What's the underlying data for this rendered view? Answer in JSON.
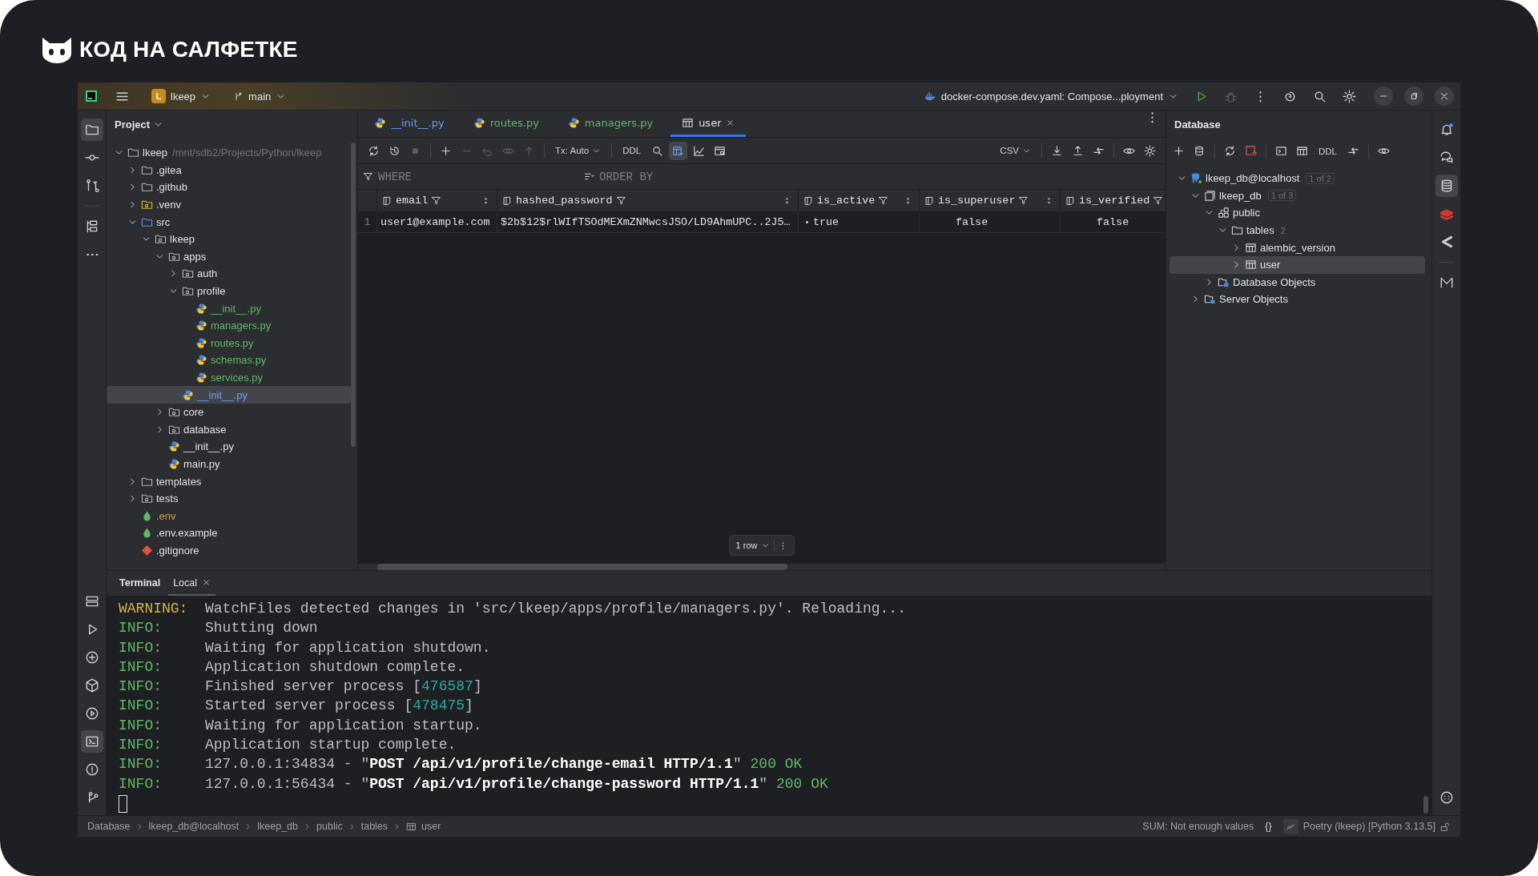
{
  "brand": {
    "name": "КОД НА САЛФЕТКЕ"
  },
  "title_bar": {
    "project_badge": "L",
    "project": "lkeep",
    "branch": "main",
    "run_config": "docker-compose.dev.yaml: Compose...ployment"
  },
  "project_panel": {
    "title": "Project",
    "tree": [
      {
        "label": "lkeep",
        "path": "/mnt/sdb2/Projects/Python/lkeep",
        "kind": "folder",
        "expanded": true,
        "selected": false,
        "color": "#dfe1e5",
        "children": [
          {
            "label": ".gitea",
            "kind": "folder",
            "expanded": false,
            "selected": false,
            "color": "#dfe1e5"
          },
          {
            "label": ".github",
            "kind": "folder",
            "expanded": false,
            "selected": false,
            "color": "#dfe1e5"
          },
          {
            "label": ".venv",
            "kind": "venv",
            "expanded": false,
            "selected": false,
            "color": "#dfe1e5"
          },
          {
            "label": "src",
            "kind": "source",
            "expanded": true,
            "selected": false,
            "color": "#dfe1e5",
            "children": [
              {
                "label": "lkeep",
                "kind": "package",
                "expanded": true,
                "selected": false,
                "color": "#dfe1e5",
                "children": [
                  {
                    "label": "apps",
                    "kind": "package",
                    "expanded": true,
                    "selected": false,
                    "color": "#dfe1e5",
                    "children": [
                      {
                        "label": "auth",
                        "kind": "package",
                        "expanded": false,
                        "selected": false,
                        "color": "#dfe1e5"
                      },
                      {
                        "label": "profile",
                        "kind": "package",
                        "expanded": true,
                        "selected": false,
                        "color": "#dfe1e5",
                        "children": [
                          {
                            "label": "__init__.py",
                            "kind": "python",
                            "selected": false,
                            "color": "#5fb865"
                          },
                          {
                            "label": "managers.py",
                            "kind": "python",
                            "selected": false,
                            "color": "#5fb865"
                          },
                          {
                            "label": "routes.py",
                            "kind": "python",
                            "selected": false,
                            "color": "#5fb865"
                          },
                          {
                            "label": "schemas.py",
                            "kind": "python",
                            "selected": false,
                            "color": "#5fb865"
                          },
                          {
                            "label": "services.py",
                            "kind": "python",
                            "selected": false,
                            "color": "#5fb865"
                          }
                        ]
                      },
                      {
                        "label": "__init__.py",
                        "kind": "python",
                        "selected": true,
                        "color": "#6c9ef8"
                      }
                    ]
                  },
                  {
                    "label": "core",
                    "kind": "package",
                    "expanded": false,
                    "selected": false,
                    "color": "#dfe1e5"
                  },
                  {
                    "label": "database",
                    "kind": "package",
                    "expanded": false,
                    "selected": false,
                    "color": "#dfe1e5"
                  },
                  {
                    "label": "__init__.py",
                    "kind": "python",
                    "selected": false,
                    "color": "#dfe1e5"
                  },
                  {
                    "label": "main.py",
                    "kind": "python",
                    "selected": false,
                    "color": "#dfe1e5"
                  }
                ]
              }
            ]
          },
          {
            "label": "templates",
            "kind": "folder",
            "expanded": false,
            "selected": false,
            "color": "#dfe1e5"
          },
          {
            "label": "tests",
            "kind": "package",
            "expanded": false,
            "selected": false,
            "color": "#dfe1e5"
          },
          {
            "label": ".env",
            "kind": "env",
            "selected": false,
            "color": "#d29a58"
          },
          {
            "label": ".env.example",
            "kind": "env",
            "selected": false,
            "color": "#dfe1e5"
          },
          {
            "label": ".gitignore",
            "kind": "git",
            "selected": false,
            "color": "#dfe1e5"
          }
        ]
      }
    ]
  },
  "editor": {
    "tabs": [
      {
        "label": "__init__.py",
        "kind": "python",
        "selected": false,
        "color": "#6c9ef8"
      },
      {
        "label": "routes.py",
        "kind": "python",
        "selected": false,
        "color": "#5fb865"
      },
      {
        "label": "managers.py",
        "kind": "python",
        "selected": false,
        "color": "#5fb865"
      },
      {
        "label": "user",
        "kind": "table",
        "selected": true,
        "color": "#dfe1e5"
      }
    ],
    "toolbar": {
      "transaction": "Tx: Auto",
      "ddl": "DDL",
      "export_format": "CSV"
    },
    "filter": {
      "where": "WHERE",
      "order_by": "ORDER BY"
    },
    "grid": {
      "columns": [
        {
          "name": "email"
        },
        {
          "name": "hashed_password"
        },
        {
          "name": "is_active"
        },
        {
          "name": "is_superuser"
        },
        {
          "name": "is_verified"
        }
      ],
      "rows": [
        {
          "number": "1",
          "cells": [
            {
              "text": "user1@example.com",
              "kind": "text",
              "current": false
            },
            {
              "text": "$2b$12$rlWIfTSOdMEXmZNMwcsJSO/LD9AhmUPC..2J5…",
              "kind": "text",
              "current": false
            },
            {
              "text": "true",
              "kind": "bool",
              "current": true
            },
            {
              "text": "false",
              "kind": "bool",
              "current": false
            },
            {
              "text": "false",
              "kind": "bool",
              "current": false
            }
          ]
        }
      ]
    },
    "row_count": "1 row"
  },
  "database_panel": {
    "title": "Database",
    "toolbar_ddl": "DDL",
    "tree": [
      {
        "label": "lkeep_db@localhost",
        "kind": "server",
        "badge": "1 of 2",
        "expanded": true,
        "selected": false,
        "children": [
          {
            "label": "lkeep_db",
            "kind": "database",
            "badge": "1 of 3",
            "expanded": true,
            "selected": false,
            "children": [
              {
                "label": "public",
                "kind": "schema",
                "expanded": true,
                "selected": false,
                "children": [
                  {
                    "label": "tables",
                    "kind": "folder",
                    "count": "2",
                    "expanded": true,
                    "selected": false,
                    "children": [
                      {
                        "label": "alembic_version",
                        "kind": "table",
                        "expanded": false,
                        "selected": false
                      },
                      {
                        "label": "user",
                        "kind": "table",
                        "expanded": false,
                        "selected": true
                      }
                    ]
                  }
                ]
              },
              {
                "label": "Database Objects",
                "kind": "objects",
                "expanded": false,
                "selected": false
              }
            ]
          },
          {
            "label": "Server Objects",
            "kind": "objects",
            "expanded": false,
            "selected": false
          }
        ]
      }
    ]
  },
  "terminal": {
    "tabs": [
      {
        "label": "Terminal",
        "selected": false
      },
      {
        "label": "Local",
        "selected": true
      }
    ],
    "lines": [
      {
        "level": "WARNING:",
        "kind": "warning",
        "parts": [
          {
            "text": "WatchFiles detected changes in 'src/lkeep/apps/profile/managers.py'. Reloading...",
            "kind": "plain"
          }
        ]
      },
      {
        "level": "INFO:",
        "kind": "info",
        "parts": [
          {
            "text": "Shutting down",
            "kind": "plain"
          }
        ]
      },
      {
        "level": "INFO:",
        "kind": "info",
        "parts": [
          {
            "text": "Waiting for application shutdown.",
            "kind": "plain"
          }
        ]
      },
      {
        "level": "INFO:",
        "kind": "info",
        "parts": [
          {
            "text": "Application shutdown complete.",
            "kind": "plain"
          }
        ]
      },
      {
        "level": "INFO:",
        "kind": "info",
        "parts": [
          {
            "text": "Finished server process [",
            "kind": "plain"
          },
          {
            "text": "476587",
            "kind": "number"
          },
          {
            "text": "]",
            "kind": "plain"
          }
        ]
      },
      {
        "level": "INFO:",
        "kind": "info",
        "parts": [
          {
            "text": "Started server process [",
            "kind": "plain"
          },
          {
            "text": "478475",
            "kind": "number"
          },
          {
            "text": "]",
            "kind": "plain"
          }
        ]
      },
      {
        "level": "INFO:",
        "kind": "info",
        "parts": [
          {
            "text": "Waiting for application startup.",
            "kind": "plain"
          }
        ]
      },
      {
        "level": "INFO:",
        "kind": "info",
        "parts": [
          {
            "text": "Application startup complete.",
            "kind": "plain"
          }
        ]
      },
      {
        "level": "INFO:",
        "kind": "info",
        "parts": [
          {
            "text": "127.0.0.1:34834 - \"",
            "kind": "plain"
          },
          {
            "text": "POST /api/v1/profile/change-email HTTP/1.1",
            "kind": "bold"
          },
          {
            "text": "\" ",
            "kind": "plain"
          },
          {
            "text": "200 OK",
            "kind": "ok"
          }
        ]
      },
      {
        "level": "INFO:",
        "kind": "info",
        "parts": [
          {
            "text": "127.0.0.1:56434 - \"",
            "kind": "plain"
          },
          {
            "text": "POST /api/v1/profile/change-password HTTP/1.1",
            "kind": "bold"
          },
          {
            "text": "\" ",
            "kind": "plain"
          },
          {
            "text": "200 OK",
            "kind": "ok"
          }
        ]
      }
    ]
  },
  "status_bar": {
    "breadcrumbs": [
      {
        "label": "Database",
        "kind": "text"
      },
      {
        "label": "lkeep_db@localhost",
        "kind": "text"
      },
      {
        "label": "lkeep_db",
        "kind": "text"
      },
      {
        "label": "public",
        "kind": "text"
      },
      {
        "label": "tables",
        "kind": "text"
      },
      {
        "label": "user",
        "kind": "table"
      }
    ],
    "sum": "SUM: Not enough values",
    "braces": "{}",
    "interpreter": "Poetry (lkeep) [Python 3.13.5]"
  }
}
